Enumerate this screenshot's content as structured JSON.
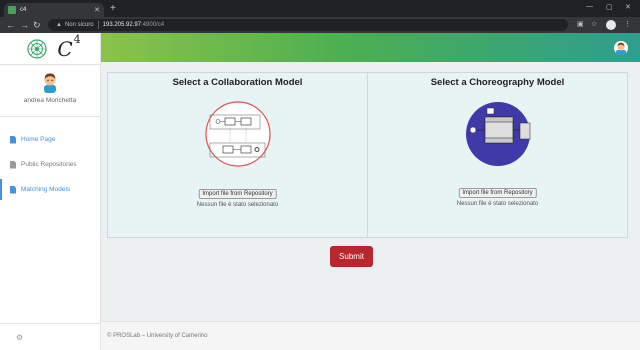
{
  "browser": {
    "tab_title": "c4",
    "tab_close": "✕",
    "new_tab": "+",
    "insecure_label": "Non sicuro",
    "url_host": "193.205.92.97",
    "url_rest": ":4900/c4"
  },
  "app": {
    "brand": "C",
    "brand_sup": "4"
  },
  "sidebar": {
    "user_name": "andrea Morichetta",
    "items": [
      {
        "label": "Home Page",
        "active": false
      },
      {
        "label": "Public Repositories",
        "active": false
      },
      {
        "label": "Matching Models",
        "active": true
      }
    ]
  },
  "main": {
    "collaboration": {
      "title": "Select a Collaboration Model",
      "button": "Import file from Repository",
      "status": "Nessun file è stato selezionato"
    },
    "choreography": {
      "title": "Select a Choreography Model",
      "button": "Import file from Repository",
      "status": "Nessun file è stato selezionato"
    },
    "submit": "Submit"
  },
  "footer": {
    "copyright": "© PROSLab – University of Camerino"
  },
  "colors": {
    "accent": "#4a90d9",
    "submit": "#b8262e",
    "header_start": "#8bc34a",
    "header_end": "#2e9e8f"
  }
}
